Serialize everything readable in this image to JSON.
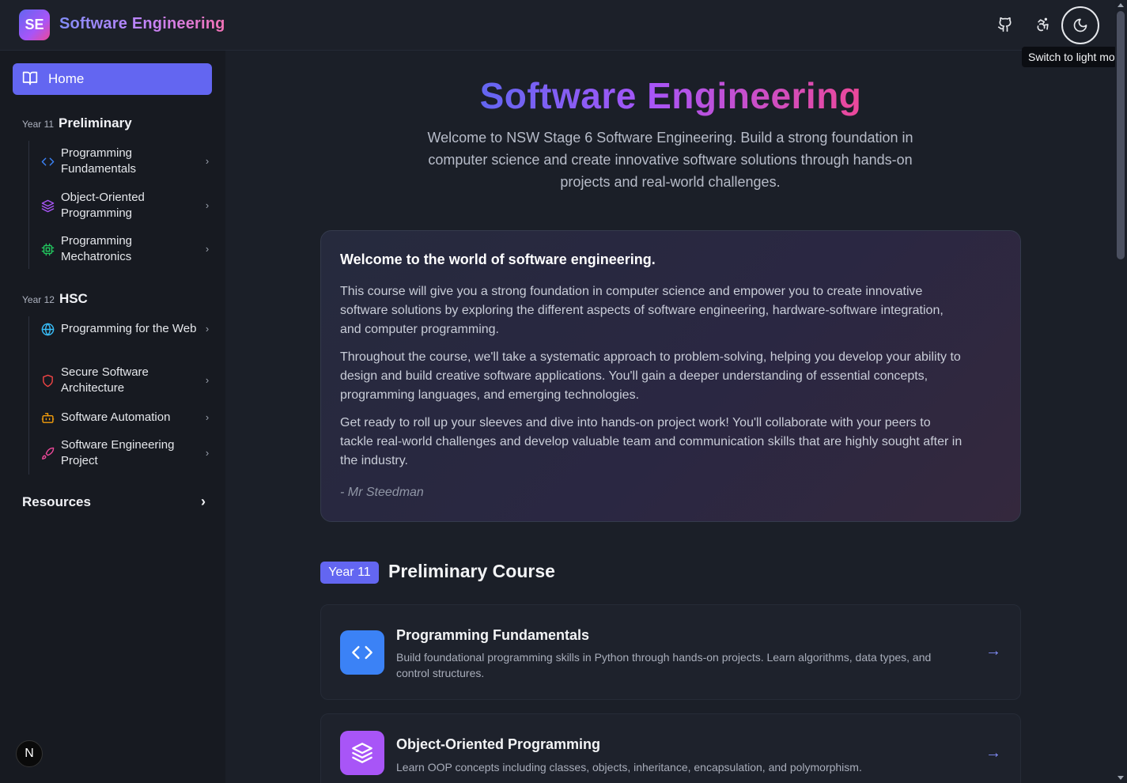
{
  "header": {
    "logo": "SE",
    "brand": "Software Engineering",
    "tooltip": "Switch to light mode",
    "icons": [
      "github-icon",
      "accessibility-icon",
      "moon-icon"
    ]
  },
  "sidebar": {
    "home": "Home",
    "sections": [
      {
        "year": "Year 11",
        "name": "Preliminary",
        "items": [
          {
            "label": "Programming Fundamentals",
            "icon": "code-icon",
            "color": "#3b82f6"
          },
          {
            "label": "Object-Oriented Programming",
            "icon": "layers-icon",
            "color": "#a855f7"
          },
          {
            "label": "Programming Mechatronics",
            "icon": "cpu-icon",
            "color": "#22c55e"
          }
        ]
      },
      {
        "year": "Year 12",
        "name": "HSC",
        "items": [
          {
            "label": "Programming for the Web",
            "icon": "globe-icon",
            "color": "#38bdf8"
          },
          {
            "label": "Secure Software Architecture",
            "icon": "shield-icon",
            "color": "#ef4444"
          },
          {
            "label": "Software Automation",
            "icon": "bot-icon",
            "color": "#f59e0b"
          },
          {
            "label": "Software Engineering Project",
            "icon": "rocket-icon",
            "color": "#ec4899"
          }
        ]
      }
    ],
    "resources": "Resources",
    "badge": "N"
  },
  "main": {
    "title": "Software Engineering",
    "subtitle": "Welcome to NSW Stage 6 Software Engineering. Build a strong foundation in computer science and create innovative software solutions through hands-on projects and real-world challenges.",
    "welcome": {
      "heading": "Welcome to the world of software engineering.",
      "paragraphs": [
        "This course will give you a strong foundation in computer science and empower you to create innovative software solutions by exploring the different aspects of software engineering, hardware-software integration, and computer programming.",
        "Throughout the course, we'll take a systematic approach to problem-solving, helping you develop your ability to design and build creative software applications. You'll gain a deeper understanding of essential concepts, programming languages, and emerging technologies.",
        "Get ready to roll up your sleeves and dive into hands-on project work! You'll collaborate with your peers to tackle real-world challenges and develop valuable team and communication skills that are highly sought after in the industry."
      ],
      "signature": "- Mr Steedman"
    },
    "course_section": {
      "year": "Year 11",
      "heading": "Preliminary Course"
    },
    "courses": [
      {
        "title": "Programming Fundamentals",
        "description": "Build foundational programming skills in Python through hands-on projects. Learn algorithms, data types, and control structures.",
        "icon": "code-icon",
        "color": "#3b82f6"
      },
      {
        "title": "Object-Oriented Programming",
        "description": "Learn OOP concepts including classes, objects, inheritance, encapsulation, and polymorphism.",
        "icon": "layers-icon",
        "color": "#a855f7"
      }
    ]
  }
}
